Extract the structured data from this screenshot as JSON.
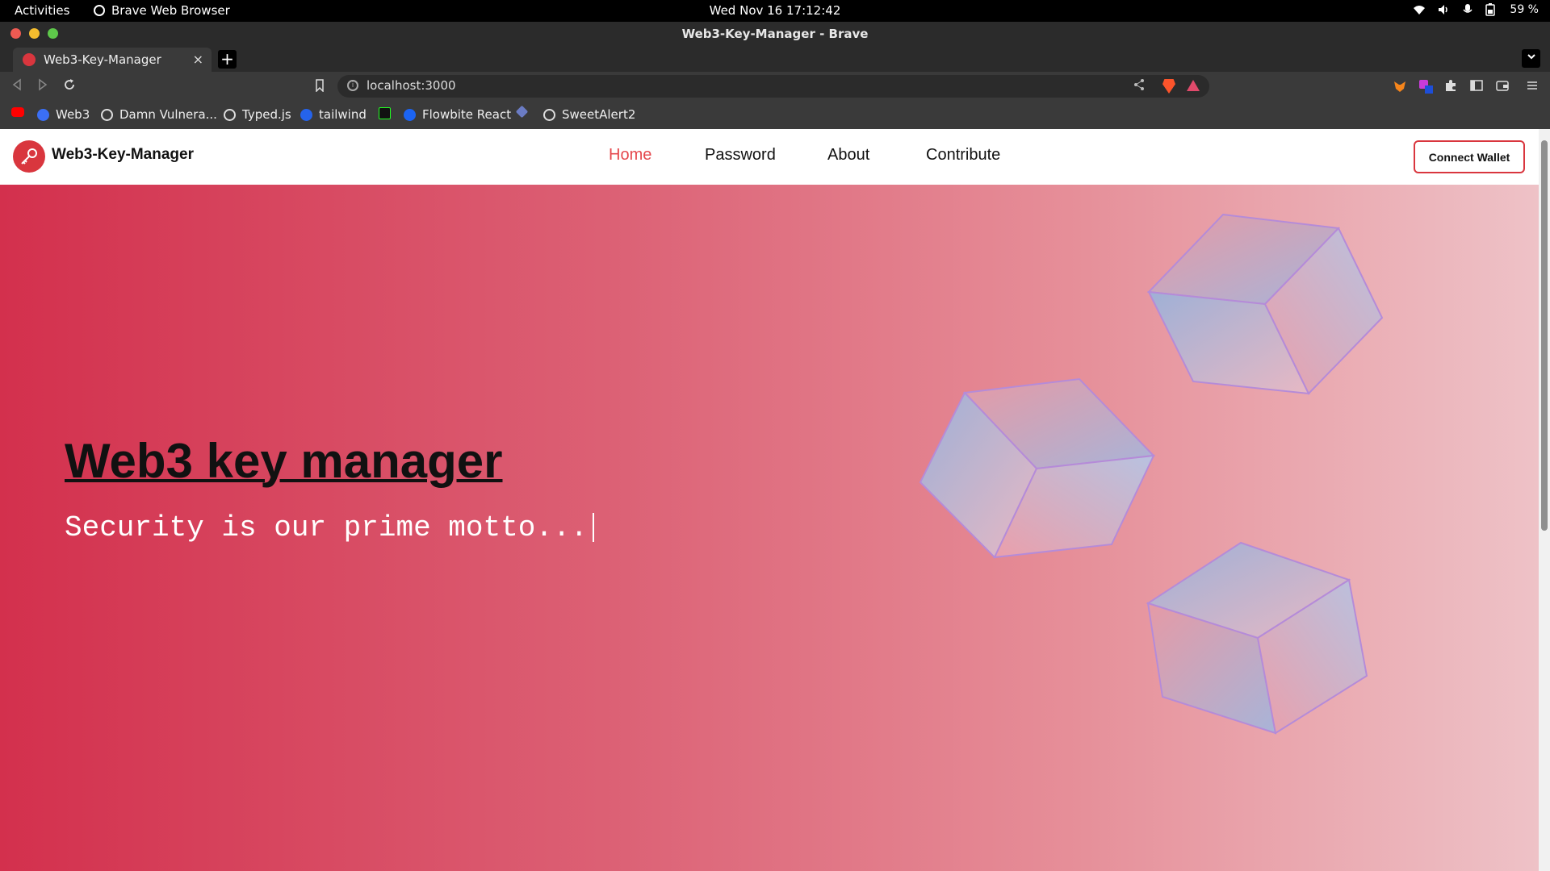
{
  "system_bar": {
    "activities": "Activities",
    "app_name": "Brave Web Browser",
    "clock": "Wed Nov 16  17:12:42",
    "battery": "59 %"
  },
  "window": {
    "title": "Web3-Key-Manager - Brave"
  },
  "tabs": [
    {
      "label": "Web3-Key-Manager",
      "close": "×"
    }
  ],
  "new_tab": "+",
  "address_bar": {
    "url": "localhost:3000"
  },
  "bookmarks": [
    {
      "label": "",
      "icon": "youtube-icon"
    },
    {
      "label": "Web3",
      "icon": "web3-icon"
    },
    {
      "label": "Damn Vulnera...",
      "icon": "globe-icon"
    },
    {
      "label": "Typed.js",
      "icon": "globe-icon"
    },
    {
      "label": "tailwind",
      "icon": "tailwind-icon"
    },
    {
      "label": "",
      "icon": "terminal-icon"
    },
    {
      "label": "Flowbite React",
      "icon": "flowbite-icon"
    },
    {
      "label": "",
      "icon": "diamond-icon"
    },
    {
      "label": "SweetAlert2",
      "icon": "globe-icon"
    }
  ],
  "site": {
    "brand": "Web3-Key-Manager",
    "nav": [
      {
        "label": "Home",
        "active": true
      },
      {
        "label": "Password",
        "active": false
      },
      {
        "label": "About",
        "active": false
      },
      {
        "label": "Contribute",
        "active": false
      }
    ],
    "connect_button": "Connect Wallet",
    "hero_title": "Web3 key manager",
    "hero_tagline": "Security is our prime motto...",
    "accent_color": "#e5484d"
  }
}
